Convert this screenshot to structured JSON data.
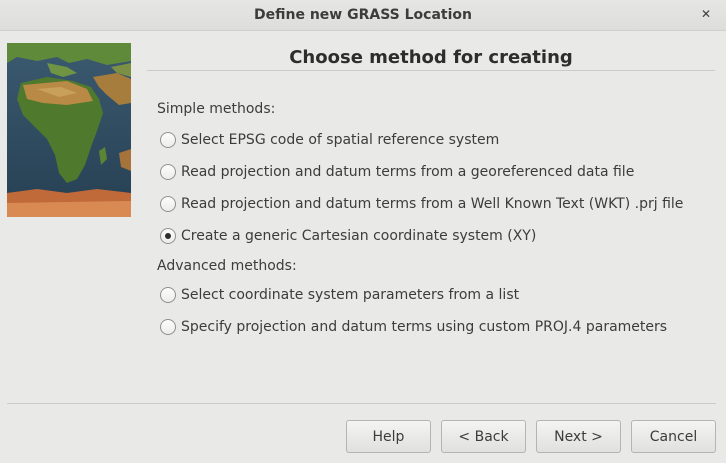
{
  "window": {
    "title": "Define new GRASS Location"
  },
  "page": {
    "heading": "Choose method for creating"
  },
  "simple": {
    "label": "Simple methods:",
    "options": [
      {
        "label": "Select EPSG code of spatial reference system",
        "checked": false
      },
      {
        "label": "Read projection and datum terms from a georeferenced data file",
        "checked": false
      },
      {
        "label": "Read projection and datum terms from a Well Known Text (WKT) .prj file",
        "checked": false
      },
      {
        "label": "Create a generic Cartesian coordinate system (XY)",
        "checked": true
      }
    ]
  },
  "advanced": {
    "label": "Advanced methods:",
    "options": [
      {
        "label": "Select coordinate system parameters from a list",
        "checked": false
      },
      {
        "label": "Specify projection and datum terms using custom PROJ.4 parameters",
        "checked": false
      }
    ]
  },
  "buttons": {
    "help": "Help",
    "back": "< Back",
    "next": "Next >",
    "cancel": "Cancel"
  },
  "icons": {
    "close": "close-icon",
    "map": "world-map-image"
  },
  "colors": {
    "ocean": "#2f4f63",
    "land_green": "#4f7a2e",
    "desert": "#b98a45",
    "antarctic": "#c06a3a"
  }
}
